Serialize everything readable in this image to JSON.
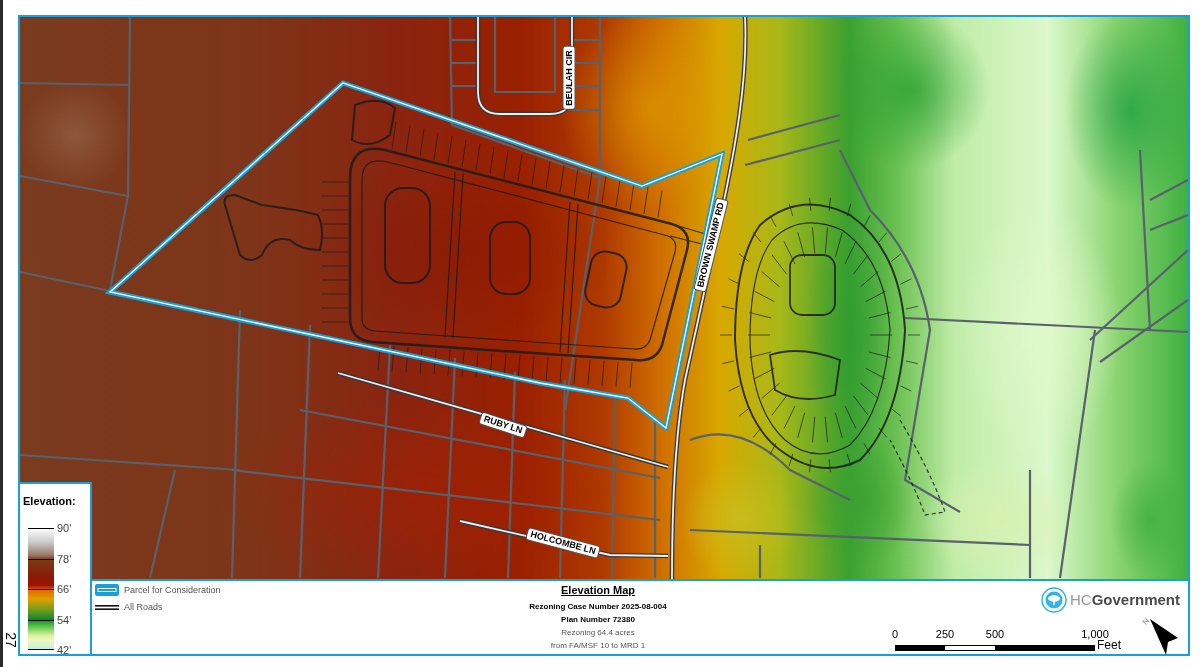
{
  "map": {
    "road_labels": [
      "BEULAH CIR",
      "BROWN SWAMP RD",
      "RUBY LN",
      "HOLCOMBE LN"
    ]
  },
  "legend": {
    "title": "Elevation:",
    "ticks": [
      "90'",
      "78'",
      "66'",
      "54'",
      "42'"
    ]
  },
  "map_key": [
    {
      "kind": "parcel",
      "label": "Parcel for Consideration"
    },
    {
      "kind": "road",
      "label": "All Roads"
    }
  ],
  "title_block": {
    "title": "Elevation Map",
    "lines": [
      {
        "text": "Rezoning Case Number 2025-08-004",
        "bold": true
      },
      {
        "text": "Plan Number 72380",
        "bold": true
      },
      {
        "text": "Rezoning 64.4 acres",
        "bold": false
      },
      {
        "text": "from FA/MSF 10 to MRD 1",
        "bold": false
      }
    ]
  },
  "logo": {
    "text": "HC**Government**"
  },
  "scale_bar": {
    "ticks": [
      "0",
      "250",
      "500",
      "1,000"
    ],
    "unit": "Feet"
  },
  "north_arrow": {
    "label": "N"
  },
  "page_number": "27"
}
